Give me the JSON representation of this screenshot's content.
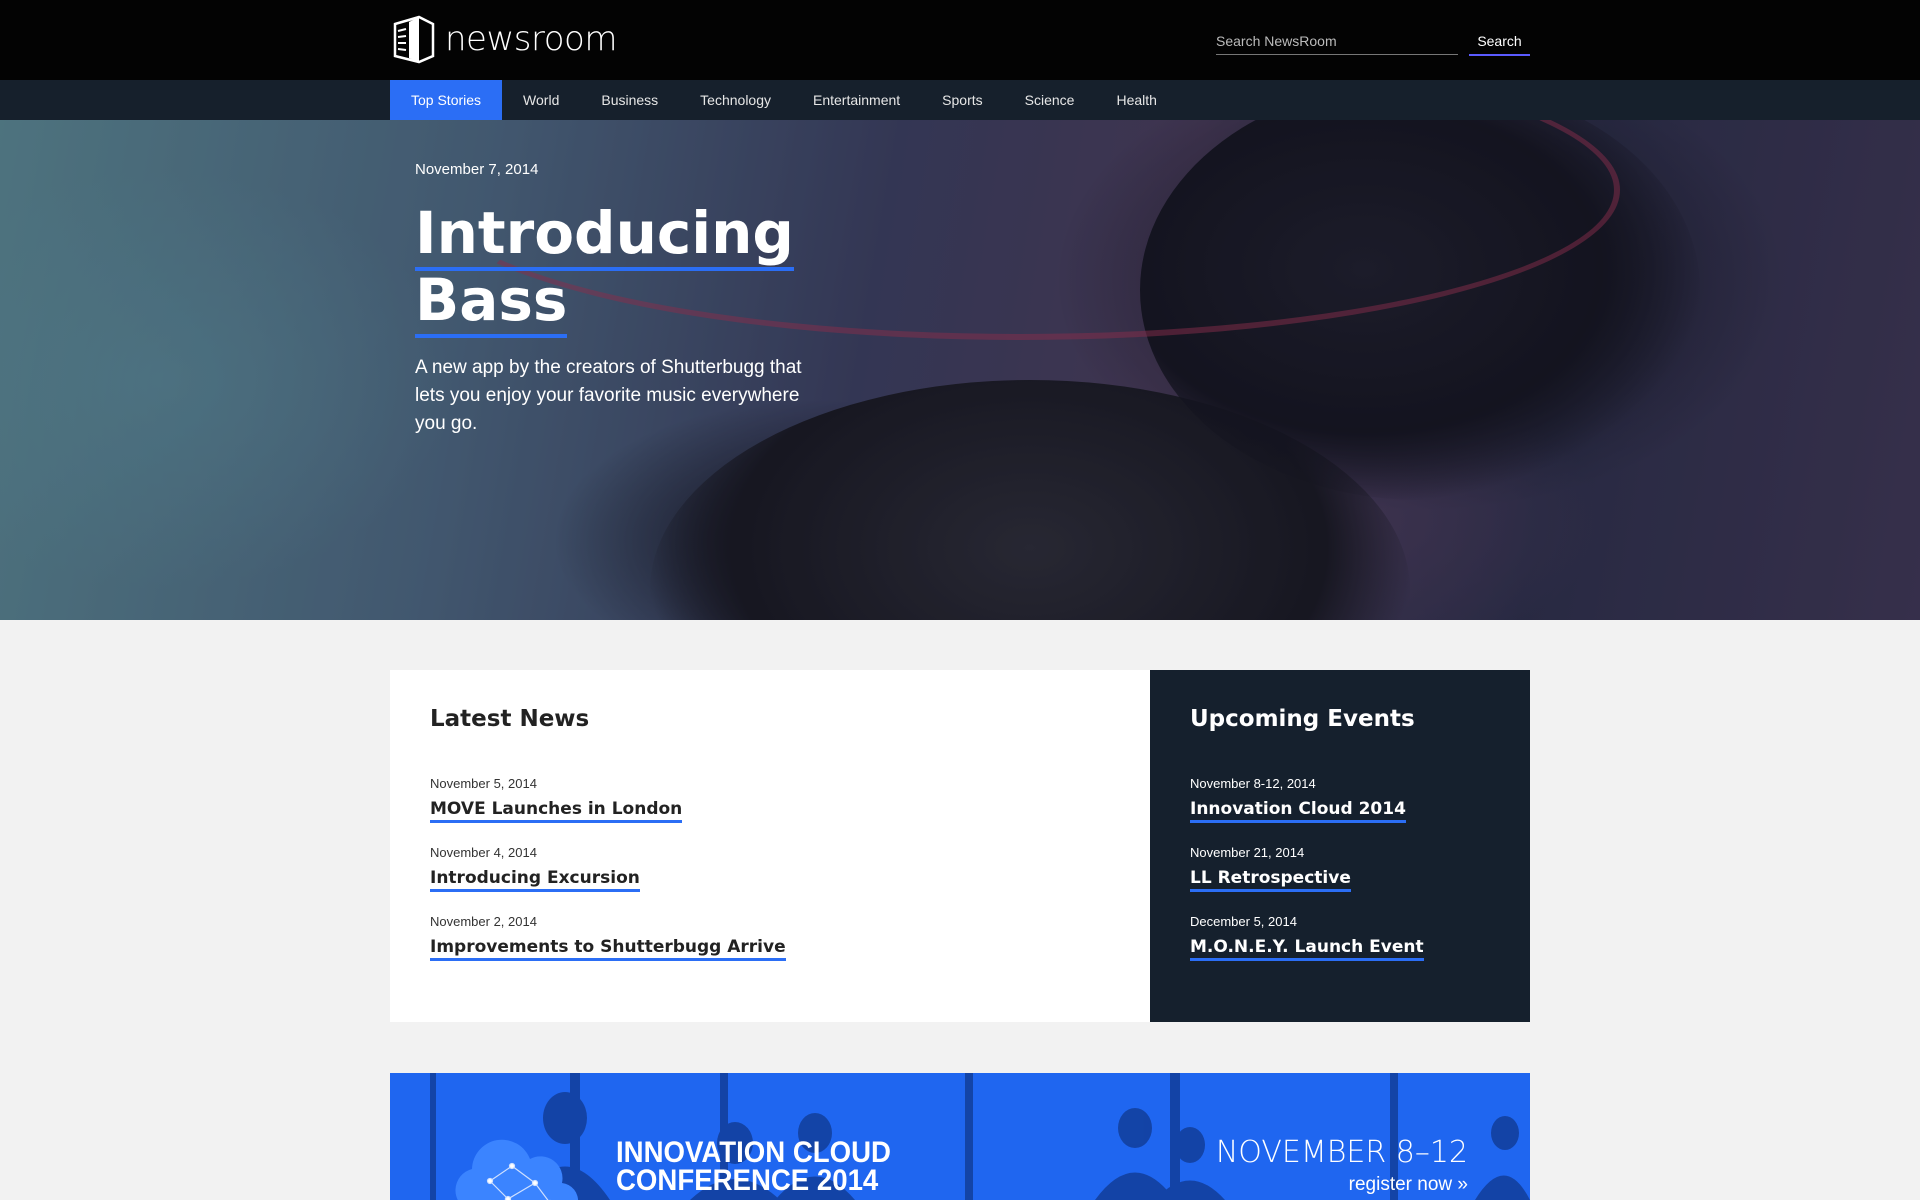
{
  "header": {
    "logo_text": "newsroom",
    "search_placeholder": "Search NewsRoom",
    "search_button": "Search"
  },
  "nav": {
    "items": [
      {
        "label": "Top Stories",
        "active": true
      },
      {
        "label": "World"
      },
      {
        "label": "Business"
      },
      {
        "label": "Technology"
      },
      {
        "label": "Entertainment"
      },
      {
        "label": "Sports"
      },
      {
        "label": "Science"
      },
      {
        "label": "Health"
      }
    ]
  },
  "hero": {
    "date": "November 7, 2014",
    "title_line1": "Introducing",
    "title_line2": "Bass",
    "subtitle": "A new app by the creators of Shutterbugg that lets you enjoy your favorite music everywhere you go."
  },
  "latest_news": {
    "title": "Latest News",
    "items": [
      {
        "date": "November 5, 2014",
        "title": "MOVE Launches in London"
      },
      {
        "date": "November 4, 2014",
        "title": "Introducing Excursion"
      },
      {
        "date": "November 2, 2014",
        "title": "Improvements to Shutterbugg Arrive"
      }
    ]
  },
  "upcoming_events": {
    "title": "Upcoming Events",
    "items": [
      {
        "date": "November 8-12, 2014",
        "title": "Innovation Cloud 2014"
      },
      {
        "date": "November 21, 2014",
        "title": "LL Retrospective"
      },
      {
        "date": "December 5, 2014",
        "title": "M.O.N.E.Y. Launch Event"
      }
    ]
  },
  "banner": {
    "title": "INNOVATION CLOUD CONFERENCE 2014",
    "dates": "NOVEMBER 8–12",
    "register": "register now »"
  },
  "colors": {
    "accent": "#2b6ef5",
    "header_bg": "#030303",
    "nav_bg": "#16202c",
    "events_bg": "#15202d",
    "banner_bg": "#1f66f0"
  }
}
